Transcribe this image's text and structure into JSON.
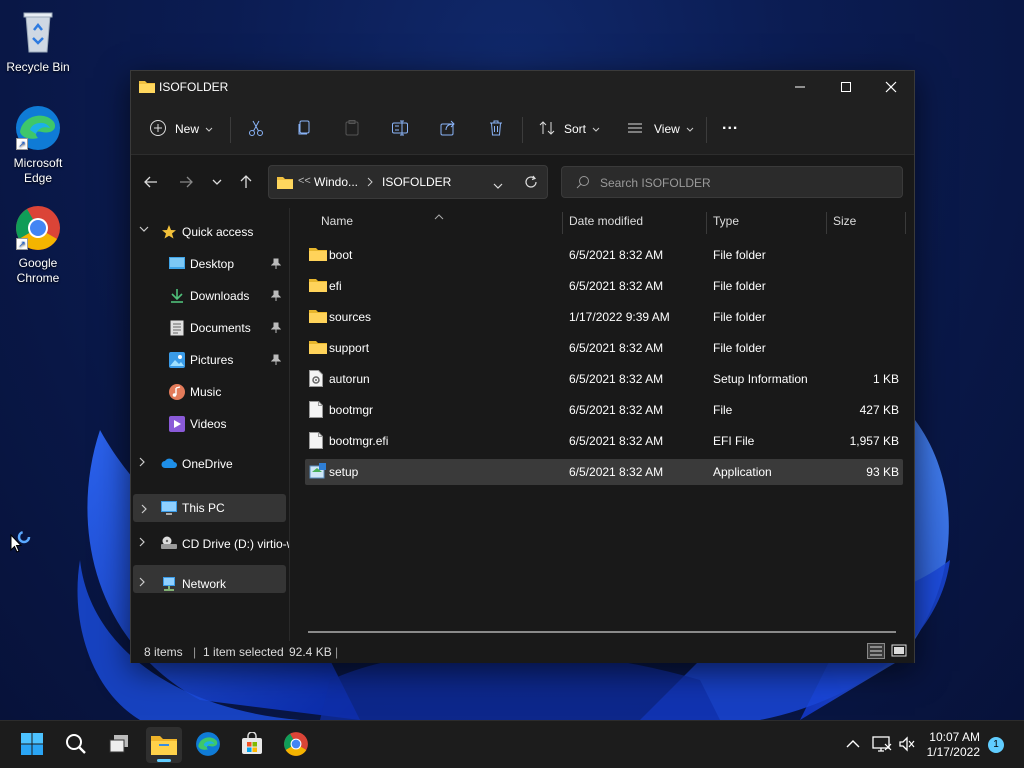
{
  "desktop": {
    "icons": [
      {
        "label": "Recycle Bin"
      },
      {
        "label": "Microsoft Edge"
      },
      {
        "label": "Google Chrome"
      }
    ]
  },
  "window": {
    "title": "ISOFOLDER",
    "toolbar": {
      "new_label": "New",
      "sort_label": "Sort",
      "view_label": "View",
      "more_label": "..."
    },
    "address": {
      "overflow": "<<",
      "crumbs": [
        "Windo...",
        "ISOFOLDER"
      ]
    },
    "search": {
      "placeholder": "Search ISOFOLDER"
    },
    "nav": {
      "quick_access": "Quick access",
      "items": [
        "Desktop",
        "Downloads",
        "Documents",
        "Pictures",
        "Music",
        "Videos"
      ],
      "onedrive": "OneDrive",
      "this_pc": "This PC",
      "cd_drive": "CD Drive (D:) virtio-win",
      "network": "Network"
    },
    "columns": {
      "name": "Name",
      "date": "Date modified",
      "type": "Type",
      "size": "Size"
    },
    "files": [
      {
        "name": "boot",
        "date": "6/5/2021 8:32 AM",
        "type": "File folder",
        "size": "",
        "icon": "folder-icon"
      },
      {
        "name": "efi",
        "date": "6/5/2021 8:32 AM",
        "type": "File folder",
        "size": "",
        "icon": "folder-icon"
      },
      {
        "name": "sources",
        "date": "1/17/2022 9:39 AM",
        "type": "File folder",
        "size": "",
        "icon": "folder-icon"
      },
      {
        "name": "support",
        "date": "6/5/2021 8:32 AM",
        "type": "File folder",
        "size": "",
        "icon": "folder-icon"
      },
      {
        "name": "autorun",
        "date": "6/5/2021 8:32 AM",
        "type": "Setup Information",
        "size": "1 KB",
        "icon": "setup-info-icon"
      },
      {
        "name": "bootmgr",
        "date": "6/5/2021 8:32 AM",
        "type": "File",
        "size": "427 KB",
        "icon": "file-icon"
      },
      {
        "name": "bootmgr.efi",
        "date": "6/5/2021 8:32 AM",
        "type": "EFI File",
        "size": "1,957 KB",
        "icon": "file-icon"
      },
      {
        "name": "setup",
        "date": "6/5/2021 8:32 AM",
        "type": "Application",
        "size": "93 KB",
        "icon": "setup-app-icon"
      }
    ],
    "status": {
      "count": "8 items",
      "sep": "|",
      "selected": "1 item selected",
      "size": "92.4 KB",
      "sep2": "|"
    }
  },
  "taskbar": {
    "time": "10:07 AM",
    "date": "1/17/2022",
    "notifications": "1"
  },
  "colors": {
    "accent": "#60cdff",
    "folder": "#f0c040",
    "window_bg": "#191919"
  }
}
